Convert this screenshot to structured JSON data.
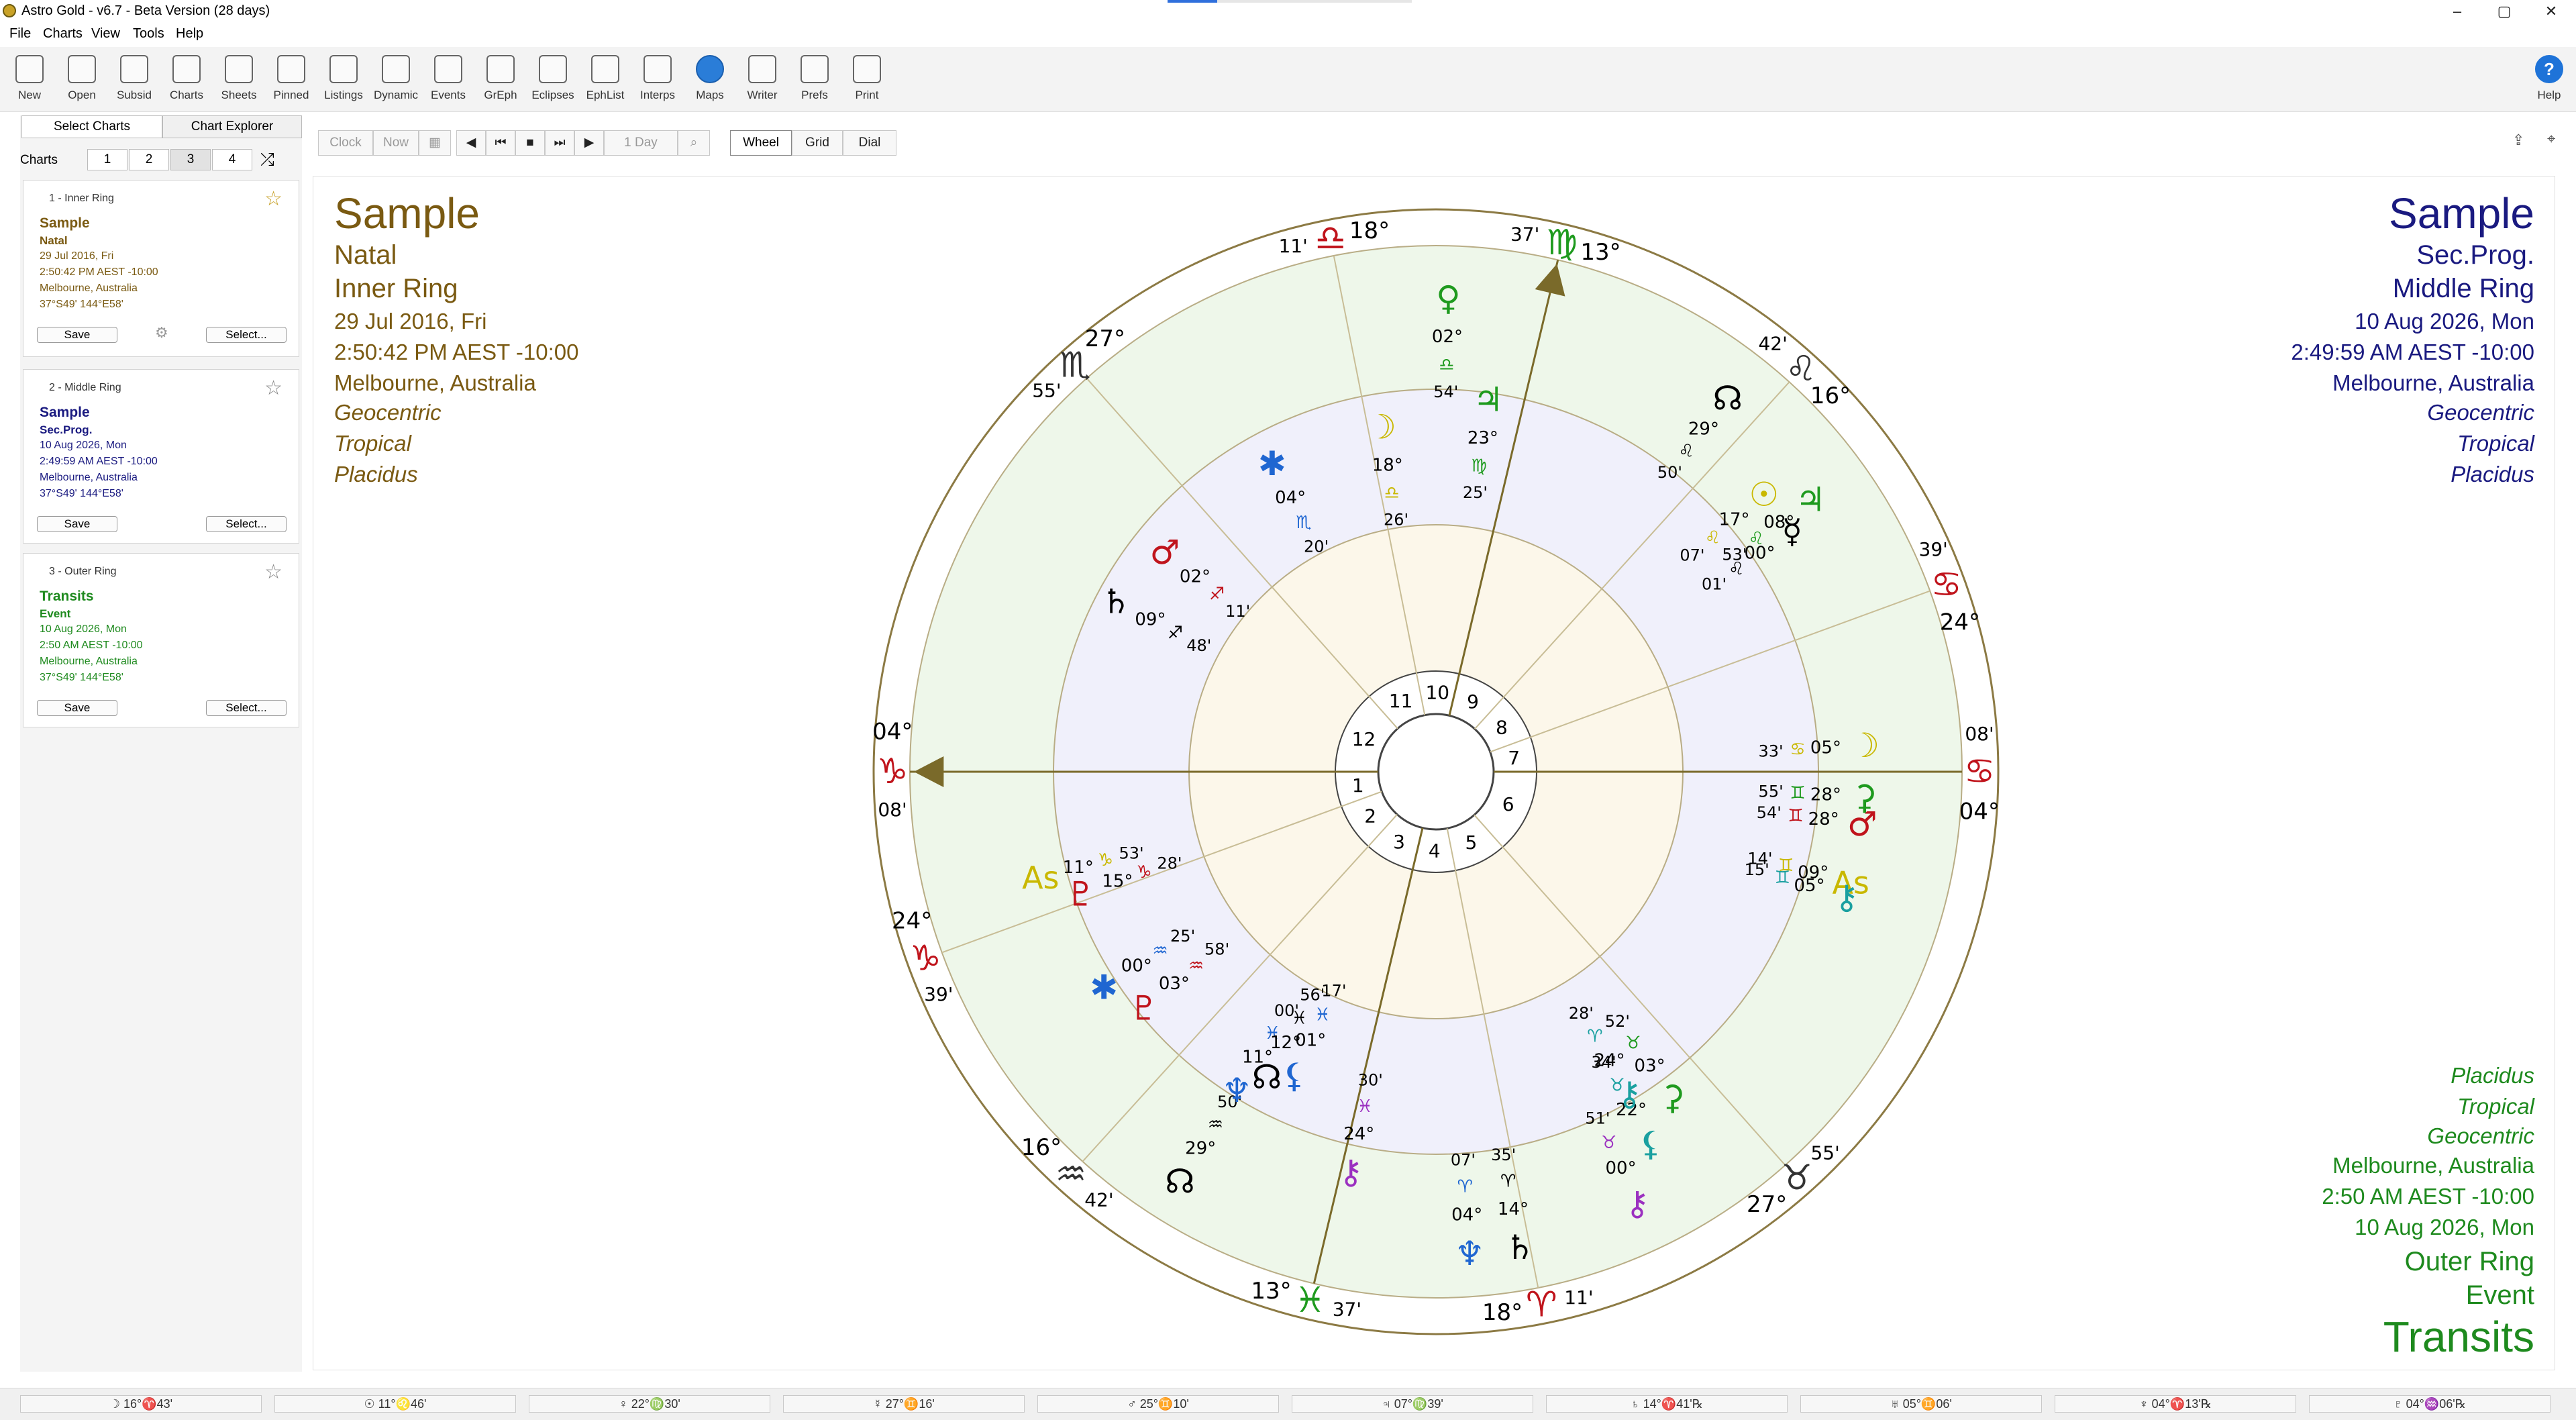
{
  "window": {
    "title": "Astro Gold - v6.7 - Beta Version (28 days)",
    "minimize": "–",
    "maximize": "▢",
    "close": "✕"
  },
  "menu": [
    "File",
    "Charts",
    "View",
    "Tools",
    "Help"
  ],
  "toolbar": [
    "New",
    "Open",
    "Subsid",
    "Charts",
    "Sheets",
    "Pinned",
    "Listings",
    "Dynamic",
    "Events",
    "GrEph",
    "Eclipses",
    "EphList",
    "Interps",
    "Maps",
    "Writer",
    "Prefs",
    "Print"
  ],
  "help_label": "Help",
  "sidebar": {
    "tabs": [
      "Select Charts",
      "Chart Explorer"
    ],
    "charts_label": "Charts",
    "chart_nums": [
      "1",
      "2",
      "3",
      "4"
    ],
    "shuffle_icon": "⤮",
    "cards": [
      {
        "header": "1 - Inner Ring",
        "name": "Sample",
        "type": "Natal",
        "date": "29 Jul 2016, Fri",
        "time": "2:50:42 PM AEST -10:00",
        "place": "Melbourne, Australia",
        "coords": "37°S49' 144°E58'",
        "save": "Save",
        "select": "Select...",
        "color": "#7a5a12",
        "star_color": "#c8a128"
      },
      {
        "header": "2 - Middle Ring",
        "name": "Sample",
        "type": "Sec.Prog.",
        "date": "10 Aug 2026, Mon",
        "time": "2:49:59 AM AEST -10:00",
        "place": "Melbourne, Australia",
        "coords": "37°S49' 144°E58'",
        "save": "Save",
        "select": "Select...",
        "color": "#1a1a80",
        "star_color": "#888888"
      },
      {
        "header": "3 - Outer Ring",
        "name": "Transits",
        "type": "Event",
        "date": "10 Aug 2026, Mon",
        "time": "2:50 AM AEST -10:00",
        "place": "Melbourne, Australia",
        "coords": "37°S49' 144°E58'",
        "save": "Save",
        "select": "Select...",
        "color": "#1e8a1e",
        "star_color": "#888888"
      }
    ]
  },
  "chart_tools": {
    "clock": "Clock",
    "now": "Now",
    "step": "1 Day",
    "views": [
      "Wheel",
      "Grid",
      "Dial"
    ],
    "active_view": "Wheel"
  },
  "inner_chart": {
    "name": "Sample",
    "type": "Natal",
    "ring": "Inner Ring",
    "date": "29 Jul 2016, Fri",
    "time": "2:50:42 PM AEST -10:00",
    "place": "Melbourne, Australia",
    "zodiac_mode": "Geocentric",
    "zodiac": "Tropical",
    "houses": "Placidus",
    "color": "#7a5a12"
  },
  "middle_chart": {
    "name": "Sample",
    "type": "Sec.Prog.",
    "ring": "Middle Ring",
    "date": "10 Aug 2026, Mon",
    "time": "2:49:59 AM AEST -10:00",
    "place": "Melbourne, Australia",
    "zodiac_mode": "Geocentric",
    "zodiac": "Tropical",
    "houses": "Placidus",
    "color": "#1a1a80"
  },
  "outer_chart": {
    "name": "Transits",
    "type": "Event",
    "ring": "Outer Ring",
    "date": "10 Aug 2026, Mon",
    "time": "2:50 AM AEST -10:00",
    "place": "Melbourne, Australia",
    "zodiac_mode": "Geocentric",
    "zodiac": "Tropical",
    "houses": "Placidus",
    "color": "#1e8a1e"
  },
  "wheel": {
    "colors": {
      "fire": "#c0141c",
      "earth": "#1e9a1e",
      "air": "#c9b800",
      "water": "#1f66d1",
      "ink": "#000000",
      "retro": "#d42020",
      "brown": "#7a5a12"
    },
    "cusps": [
      {
        "deg": "04°",
        "min": "08'",
        "glyph": "♑",
        "color": "#c0141c"
      },
      {
        "deg": "24°",
        "min": "39'",
        "glyph": "♑",
        "color": "#c0141c"
      },
      {
        "deg": "16°",
        "min": "42'",
        "glyph": "♒",
        "color": "#333333"
      },
      {
        "deg": "13°",
        "min": "37'",
        "glyph": "♓",
        "color": "#1e9a1e"
      },
      {
        "deg": "18°",
        "min": "11'",
        "glyph": "♈",
        "color": "#c0141c"
      },
      {
        "deg": "27°",
        "min": "55'",
        "glyph": "♉",
        "color": "#333333"
      },
      {
        "deg": "04°",
        "min": "08'",
        "glyph": "♋",
        "color": "#c0141c"
      },
      {
        "deg": "24°",
        "min": "39'",
        "glyph": "♋",
        "color": "#c0141c"
      },
      {
        "deg": "16°",
        "min": "42'",
        "glyph": "♌",
        "color": "#333333"
      },
      {
        "deg": "13°",
        "min": "37'",
        "glyph": "♍",
        "color": "#1e9a1e"
      },
      {
        "deg": "18°",
        "min": "11'",
        "glyph": "♎",
        "color": "#c0141c"
      },
      {
        "deg": "27°",
        "min": "55'",
        "glyph": "♏",
        "color": "#333333"
      }
    ],
    "house_numbers": [
      "1",
      "2",
      "3",
      "4",
      "5",
      "6",
      "7",
      "8",
      "9",
      "10",
      "11",
      "12"
    ],
    "planets": [
      {
        "glyph": "☽",
        "color": "#c9b800",
        "deg": "05°",
        "sign": "♋",
        "min": "33'"
      },
      {
        "glyph": "⚳",
        "color": "#1e9a1e",
        "deg": "28°",
        "sign": "♊",
        "min": "55'"
      },
      {
        "glyph": "♂",
        "color": "#c0141c",
        "deg": "28°",
        "sign": "♊",
        "min": "54'"
      },
      {
        "glyph": "As",
        "color": "#c9b800",
        "deg": "09°",
        "sign": "♊",
        "min": "14'"
      },
      {
        "glyph": "⚷",
        "color": "#1aa0a0",
        "deg": "05°",
        "sign": "♊",
        "min": "15'"
      },
      {
        "glyph": "☉",
        "color": "#c9b800",
        "deg": "17°",
        "sign": "♌",
        "min": "07'"
      },
      {
        "glyph": "☊",
        "color": "#000000",
        "deg": "29°",
        "sign": "♌",
        "min": "50'"
      },
      {
        "glyph": "♃",
        "color": "#1e9a1e",
        "deg": "08°",
        "sign": "♌",
        "min": "53'"
      },
      {
        "glyph": "☿",
        "color": "#000000",
        "deg": "00°",
        "sign": "♌",
        "min": "01'"
      },
      {
        "glyph": "♀",
        "color": "#1e9a1e",
        "deg": "02°",
        "sign": "♎",
        "min": "54'"
      },
      {
        "glyph": "♃",
        "color": "#1e9a1e",
        "deg": "23°",
        "sign": "♍",
        "min": "25'"
      },
      {
        "glyph": "☽",
        "color": "#c9b800",
        "deg": "18°",
        "sign": "♎",
        "min": "26'"
      },
      {
        "glyph": "✱",
        "color": "#1f66d1",
        "deg": "04°",
        "sign": "♏",
        "min": "20'"
      },
      {
        "glyph": "♂",
        "color": "#c0141c",
        "deg": "02°",
        "sign": "♐",
        "min": "11'"
      },
      {
        "glyph": "♄",
        "color": "#000000",
        "deg": "09°",
        "sign": "♐",
        "min": "48'"
      },
      {
        "glyph": "As",
        "color": "#c9b800",
        "deg": "11°",
        "sign": "♑",
        "min": "53'"
      },
      {
        "glyph": "♇",
        "color": "#c0141c",
        "deg": "15°",
        "sign": "♑",
        "min": "28'"
      },
      {
        "glyph": "✱",
        "color": "#1f66d1",
        "deg": "00°",
        "sign": "♒",
        "min": "25'"
      },
      {
        "glyph": "♇",
        "color": "#c0141c",
        "deg": "03°",
        "sign": "♒",
        "min": "58'"
      },
      {
        "glyph": "☊",
        "color": "#000000",
        "deg": "29°",
        "sign": "♒",
        "min": "50'"
      },
      {
        "glyph": "♆",
        "color": "#1f66d1",
        "deg": "04°",
        "sign": "♈",
        "min": "07'"
      },
      {
        "glyph": "♄",
        "color": "#000000",
        "deg": "14°",
        "sign": "♈",
        "min": "35'"
      },
      {
        "glyph": "⚸",
        "color": "#1aa0a0",
        "deg": "22°",
        "sign": "♉",
        "min": "34'"
      },
      {
        "glyph": "⚷",
        "color": "#9b30c0",
        "deg": "00°",
        "sign": "♉",
        "min": "51'"
      },
      {
        "glyph": "⚳",
        "color": "#1e9a1e",
        "deg": "03°",
        "sign": "♉",
        "min": "52'"
      },
      {
        "glyph": "⚷",
        "color": "#1aa0a0",
        "deg": "24°",
        "sign": "♈",
        "min": "28'"
      },
      {
        "glyph": "⚷",
        "color": "#9b30c0",
        "deg": "24°",
        "sign": "♓",
        "min": "30'"
      },
      {
        "glyph": "♆",
        "color": "#1f66d1",
        "deg": "11°",
        "sign": "♓",
        "min": "00'"
      },
      {
        "glyph": "☊",
        "color": "#000000",
        "deg": "12°",
        "sign": "♓",
        "min": "56'"
      },
      {
        "glyph": "⚸",
        "color": "#1f66d1",
        "deg": "01°",
        "sign": "♓",
        "min": "17'"
      }
    ]
  },
  "status_bar": [
    "☽ 16°♈43'",
    "☉ 11°♌46'",
    "♀ 22°♍30'",
    "☿ 27°♊16'",
    "♂ 25°♊10'",
    "♃ 07°♍39'",
    "♄ 14°♈41'℞",
    "♅ 05°♊06'",
    "♆ 04°♈13'℞",
    "♇ 04°♒06'℞"
  ]
}
